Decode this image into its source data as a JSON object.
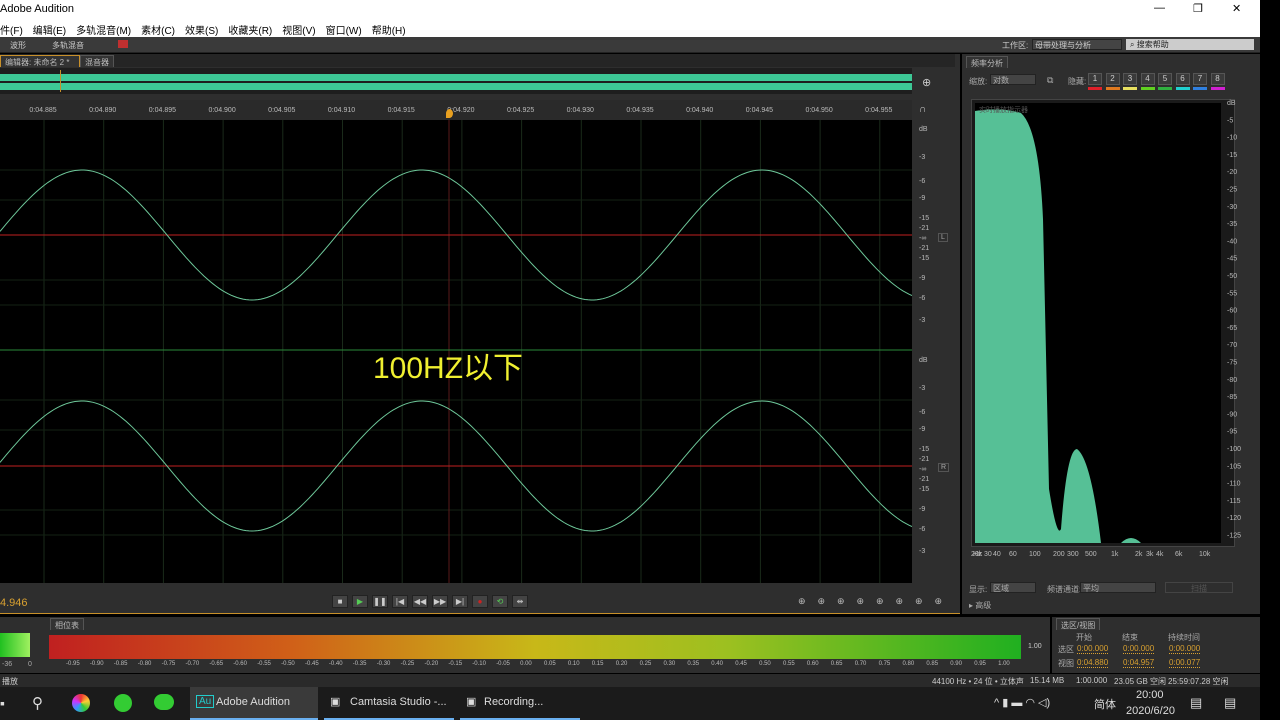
{
  "window": {
    "title": "Adobe Audition",
    "controls": [
      "—",
      "❐",
      "✕"
    ]
  },
  "menu": [
    "件(F)",
    "编辑(E)",
    "多轨混音(M)",
    "素材(C)",
    "效果(S)",
    "收藏夹(R)",
    "视图(V)",
    "窗口(W)",
    "帮助(H)"
  ],
  "toolbar": {
    "waveform": "波形",
    "multitrack": "多轨混音",
    "workspace_label": "工作区:",
    "workspace_value": "母带处理与分析",
    "search_placeholder": "搜索帮助"
  },
  "editor": {
    "tab_label": "编辑器: 未命名 2 *",
    "mixer_tab": "混音器",
    "ruler": [
      "0:04.885",
      "0:04.890",
      "0:04.895",
      "0:04.900",
      "0:04.905",
      "0:04.910",
      "0:04.915",
      "0:04.920",
      "0:04.925",
      "0:04.930",
      "0:04.935",
      "0:04.940",
      "0:04.945",
      "0:04.950",
      "0:04.955"
    ],
    "db_labels_top": [
      "dB",
      "-3",
      "-6",
      "-9",
      "-15",
      "-21",
      "-∞",
      "-21",
      "-15",
      "-9",
      "-6",
      "-3"
    ],
    "db_labels_bottom": [
      "dB",
      "-3",
      "-6",
      "-9",
      "-15",
      "-21",
      "-∞",
      "-21",
      "-15",
      "-9",
      "-6",
      "-3"
    ],
    "channel_left": "L",
    "channel_right": "R",
    "overlay_caption": "100HZ以下",
    "current_time": "4.946"
  },
  "spectrum": {
    "tab": "频率分析",
    "scale_label": "缩放:",
    "scale_value": "对数",
    "hold_label": "隐藏:",
    "holds": [
      "1",
      "2",
      "3",
      "4",
      "5",
      "6",
      "7",
      "8"
    ],
    "hold_colors": [
      "#e0202a",
      "#e07a20",
      "#e8e060",
      "#60d020",
      "#30b040",
      "#20d0d0",
      "#3080e0",
      "#d020d0"
    ],
    "graph_title": "实时播放指示器",
    "db_ticks": [
      "dB",
      "-5",
      "-10",
      "-15",
      "-20",
      "-25",
      "-30",
      "-35",
      "-40",
      "-45",
      "-50",
      "-55",
      "-60",
      "-65",
      "-70",
      "-75",
      "-80",
      "-85",
      "-90",
      "-95",
      "-100",
      "-105",
      "-110",
      "-115",
      "-120",
      "-125"
    ],
    "freq_ticks": [
      "Hz",
      "30",
      "40",
      "60",
      "100",
      "200",
      "300",
      "500",
      "1k",
      "2k",
      "3k",
      "4k",
      "6k",
      "10k",
      "20k"
    ],
    "display_label": "显示:",
    "display_value": "区域",
    "channel_label": "频谱通道:",
    "channel_value": "平均",
    "scan_button": "扫描",
    "advanced": "高级"
  },
  "meter": {
    "tab": "相位表",
    "left_ticks": [
      "-36",
      "0"
    ],
    "ticks": [
      "-0.95",
      "-0.90",
      "-0.85",
      "-0.80",
      "-0.75",
      "-0.70",
      "-0.65",
      "-0.60",
      "-0.55",
      "-0.50",
      "-0.45",
      "-0.40",
      "-0.35",
      "-0.30",
      "-0.25",
      "-0.20",
      "-0.15",
      "-0.10",
      "-0.05",
      "0.00",
      "0.05",
      "0.10",
      "0.15",
      "0.20",
      "0.25",
      "0.30",
      "0.35",
      "0.40",
      "0.45",
      "0.50",
      "0.55",
      "0.60",
      "0.65",
      "0.70",
      "0.75",
      "0.80",
      "0.85",
      "0.90",
      "0.95",
      "1.00"
    ],
    "value_label": "1.00"
  },
  "selection": {
    "tab": "选区/视图",
    "headers": [
      "开始",
      "结束",
      "持续时间"
    ],
    "rows": [
      {
        "label": "选区",
        "values": [
          "0:00.000",
          "0:00.000",
          "0:00.000"
        ]
      },
      {
        "label": "视图",
        "values": [
          "0:04.880",
          "0:04.957",
          "0:00.077"
        ]
      }
    ]
  },
  "status": {
    "left": "播放",
    "format": "44100 Hz • 24 位 • 立体声",
    "size": "15.14 MB",
    "duration": "1:00.000",
    "disk": "23.05 GB 空闲",
    "time_free": "25:59:07.28 空闲"
  },
  "taskbar": {
    "apps": [
      "Adobe Audition",
      "Camtasia Studio -...",
      "Recording..."
    ],
    "ime": "简体",
    "time": "20:00",
    "date": "2020/6/20"
  }
}
